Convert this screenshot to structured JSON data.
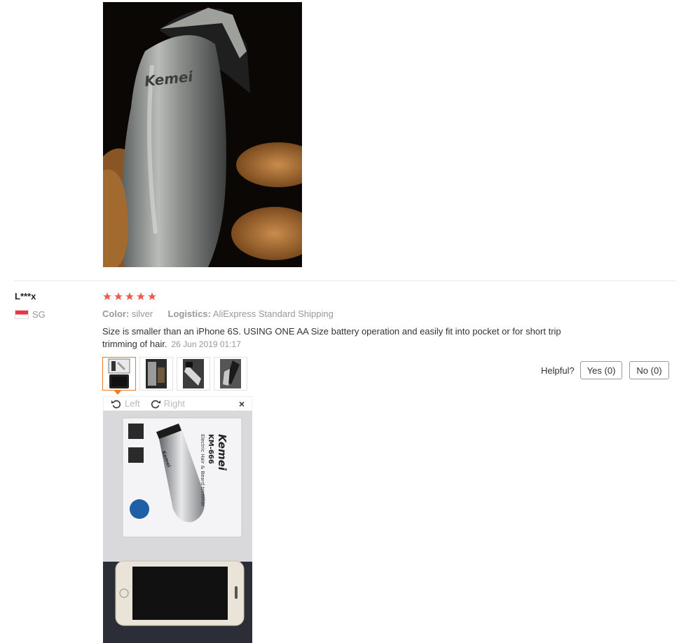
{
  "review": {
    "user_name": "L***x",
    "country": "SG",
    "rating": 5,
    "color_label": "Color:",
    "color_value": "silver",
    "logistics_label": "Logistics:",
    "logistics_value": "AliExpress Standard Shipping",
    "text": "Size is smaller than an iPhone 6S. USING ONE AA Size battery operation and easily fit into pocket or for short trip trimming of hair.",
    "date": "26 Jun 2019 01:17"
  },
  "helpful": {
    "label": "Helpful?",
    "yes_label": "Yes (0)",
    "no_label": "No (0)"
  },
  "viewer": {
    "rotate_left_label": "Left",
    "rotate_right_label": "Right",
    "close_label": "×"
  },
  "product_brand": "Kemei",
  "box_model": "KM-666",
  "box_subtitle": "Electric Hair & Beard trimmer",
  "colors": {
    "star": "#f05a4a",
    "active_thumb_border": "#f27a1a"
  },
  "icons": [
    "star-icon",
    "rotate-left-icon",
    "rotate-right-icon",
    "close-icon",
    "flag-icon"
  ]
}
